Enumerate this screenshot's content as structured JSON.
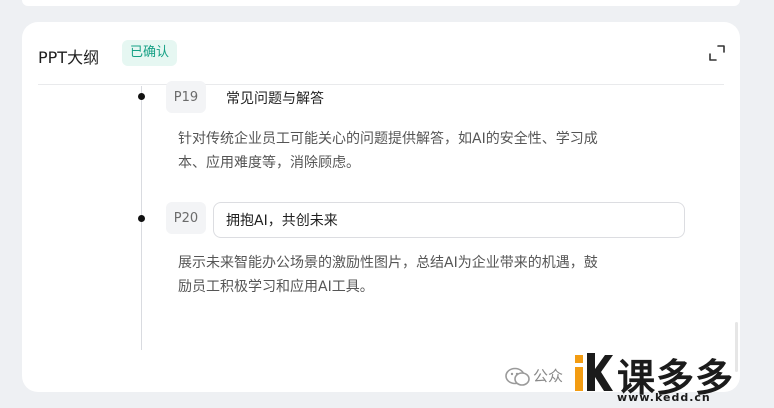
{
  "panel": {
    "title": "PPT大纲",
    "badge": "已确认"
  },
  "slides": [
    {
      "page": "P19",
      "title": "常见问题与解答",
      "desc_lines": [
        "针对传统企业员工可能关心的问题提供解答，如AI的安全性、学习成",
        "本、应用难度等，消除顾虑。"
      ]
    },
    {
      "page": "P20",
      "title": "拥抱AI，共创未来",
      "desc_lines": [
        "展示未来智能办公场景的激励性图片，总结AI为企业带来的机遇，鼓",
        "励员工积极学习和应用AI工具。"
      ]
    }
  ],
  "watermark": {
    "account": "公众",
    "brand": "课多多",
    "url": "www.kedd.cn"
  },
  "colors": {
    "badge_bg": "#e6f7f2",
    "badge_text": "#16a085",
    "logo_orange": "#f39c12"
  }
}
